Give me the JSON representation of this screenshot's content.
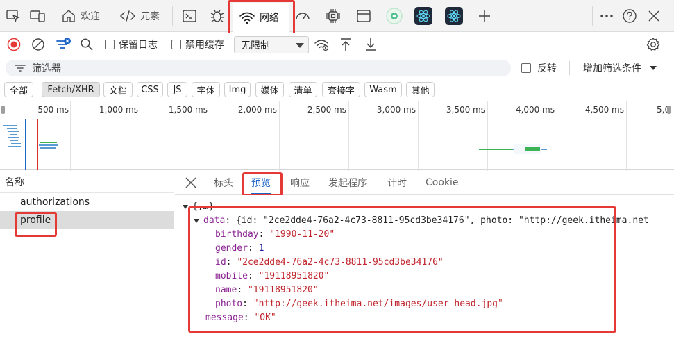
{
  "toolbar": {
    "tabs": {
      "welcome": "欢迎",
      "elements": "元素",
      "network": "网络"
    }
  },
  "network": {
    "preserve_log": "保留日志",
    "disable_cache": "禁用缓存",
    "throttling": "无限制",
    "filter_placeholder": "筛选器",
    "invert": "反转",
    "more_filters": "增加筛选条件",
    "types": [
      "全部",
      "Fetch/XHR",
      "文档",
      "CSS",
      "JS",
      "字体",
      "Img",
      "媒体",
      "清单",
      "套接字",
      "Wasm",
      "其他"
    ],
    "timeline_ticks": [
      "500 ms",
      "1,000 ms",
      "1,500 ms",
      "2,000 ms",
      "2,500 ms",
      "3,000 ms",
      "3,500 ms",
      "4,000 ms",
      "4,500 ms",
      "5,0"
    ]
  },
  "requests": {
    "header": "名称",
    "items": [
      "authorizations",
      "profile"
    ]
  },
  "details": {
    "tabs": [
      "标头",
      "预览",
      "响应",
      "发起程序",
      "计时",
      "Cookie"
    ]
  },
  "preview": {
    "root": "{,…}",
    "data_key": "data",
    "data_summary": "{id: \"2ce2dde4-76a2-4c73-8811-95cd3be34176\", photo: \"http://geek.itheima.net",
    "fields": [
      {
        "key": "birthday",
        "value": "\"1990-11-20\"",
        "type": "string"
      },
      {
        "key": "gender",
        "value": "1",
        "type": "number"
      },
      {
        "key": "id",
        "value": "\"2ce2dde4-76a2-4c73-8811-95cd3be34176\"",
        "type": "string"
      },
      {
        "key": "mobile",
        "value": "\"19118951820\"",
        "type": "string"
      },
      {
        "key": "name",
        "value": "\"19118951820\"",
        "type": "string"
      },
      {
        "key": "photo",
        "value": "\"http://geek.itheima.net/images/user_head.jpg\"",
        "type": "string"
      }
    ],
    "message_key": "message",
    "message_value": "\"OK\""
  },
  "colors": {
    "highlight": "#e53935",
    "accent": "#1a64c8",
    "key": "#8a2392",
    "string": "#c0262d",
    "number": "#1a1aa6"
  }
}
